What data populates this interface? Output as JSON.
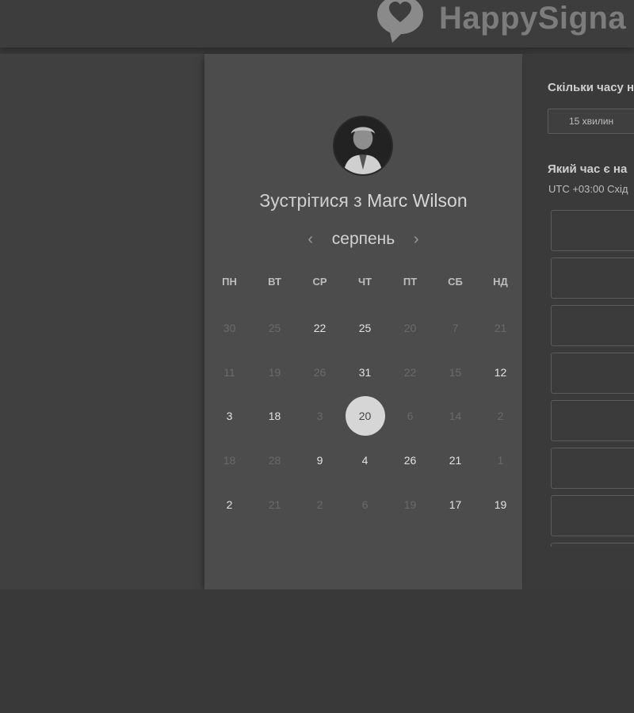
{
  "brand": {
    "name": "HappySigna",
    "logo_icon": "speech-bubble-heart-icon"
  },
  "scheduler": {
    "title_prefix": "Зустрітися з",
    "host_name": "Marc Wilson",
    "month": "серпень",
    "prev_icon": "‹",
    "next_icon": "›",
    "weekdays": [
      "ПН",
      "ВТ",
      "СР",
      "ЧТ",
      "ПТ",
      "СБ",
      "НД"
    ],
    "days": [
      {
        "label": "30",
        "available": false,
        "selected": false
      },
      {
        "label": "25",
        "available": false,
        "selected": false
      },
      {
        "label": "22",
        "available": true,
        "selected": false
      },
      {
        "label": "25",
        "available": true,
        "selected": false
      },
      {
        "label": "20",
        "available": false,
        "selected": false
      },
      {
        "label": "7",
        "available": false,
        "selected": false
      },
      {
        "label": "21",
        "available": false,
        "selected": false
      },
      {
        "label": "11",
        "available": false,
        "selected": false
      },
      {
        "label": "19",
        "available": false,
        "selected": false
      },
      {
        "label": "26",
        "available": false,
        "selected": false
      },
      {
        "label": "31",
        "available": true,
        "selected": false
      },
      {
        "label": "22",
        "available": false,
        "selected": false
      },
      {
        "label": "15",
        "available": false,
        "selected": false
      },
      {
        "label": "12",
        "available": true,
        "selected": false
      },
      {
        "label": "3",
        "available": true,
        "selected": false
      },
      {
        "label": "18",
        "available": true,
        "selected": false
      },
      {
        "label": "3",
        "available": false,
        "selected": false
      },
      {
        "label": "20",
        "available": true,
        "selected": true
      },
      {
        "label": "6",
        "available": false,
        "selected": false
      },
      {
        "label": "14",
        "available": false,
        "selected": false
      },
      {
        "label": "2",
        "available": false,
        "selected": false
      },
      {
        "label": "18",
        "available": false,
        "selected": false
      },
      {
        "label": "28",
        "available": false,
        "selected": false
      },
      {
        "label": "9",
        "available": true,
        "selected": false
      },
      {
        "label": "4",
        "available": true,
        "selected": false
      },
      {
        "label": "26",
        "available": true,
        "selected": false
      },
      {
        "label": "21",
        "available": true,
        "selected": false
      },
      {
        "label": "1",
        "available": false,
        "selected": false
      },
      {
        "label": "2",
        "available": true,
        "selected": false
      },
      {
        "label": "21",
        "available": false,
        "selected": false
      },
      {
        "label": "2",
        "available": false,
        "selected": false
      },
      {
        "label": "6",
        "available": false,
        "selected": false
      },
      {
        "label": "19",
        "available": false,
        "selected": false
      },
      {
        "label": "17",
        "available": true,
        "selected": false
      },
      {
        "label": "19",
        "available": true,
        "selected": false
      }
    ]
  },
  "details": {
    "duration_question": "Скільки часу н",
    "duration_value": "15 хвилин",
    "time_question": "Який час є на",
    "timezone": "UTC +03:00 Схід",
    "slot_count": 8
  },
  "colors": {
    "background": "#3a3a3a",
    "card": "#4c4c4c",
    "selected_day": "#d6d6d6",
    "available_text": "#e3e3e3",
    "unavailable_text": "#6a6a6a"
  }
}
